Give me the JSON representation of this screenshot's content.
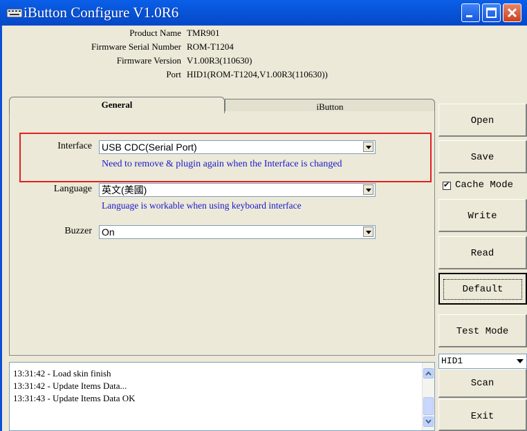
{
  "window": {
    "title": "iButton Configure V1.0R6"
  },
  "info": [
    {
      "label": "Product Name",
      "value": "TMR901"
    },
    {
      "label": "Firmware Serial Number",
      "value": "ROM-T1204"
    },
    {
      "label": "Firmware Version",
      "value": "V1.00R3(110630)"
    },
    {
      "label": "Port",
      "value": "HID1(ROM-T1204,V1.00R3(110630))"
    }
  ],
  "tabs": [
    "General",
    "iButton"
  ],
  "form": {
    "interface_label": "Interface",
    "interface_value": "USB CDC(Serial Port)",
    "interface_hint": "Need to remove & plugin again when the Interface is changed",
    "language_label": "Language",
    "language_value": "英文(美國)",
    "language_hint": "Language is workable when using keyboard interface",
    "buzzer_label": "Buzzer",
    "buzzer_value": "On"
  },
  "buttons": {
    "open": "Open",
    "save": "Save",
    "write": "Write",
    "read": "Read",
    "default": "Default",
    "test_mode": "Test Mode",
    "scan": "Scan",
    "exit": "Exit"
  },
  "cache_mode": {
    "label": "Cache Mode",
    "checked": true,
    "mark": "✔"
  },
  "port_select": "HID1",
  "log": [
    "13:31:42 - Load skin finish",
    "13:31:42 - Update Items Data...",
    "13:31:43 - Update Items Data OK"
  ]
}
